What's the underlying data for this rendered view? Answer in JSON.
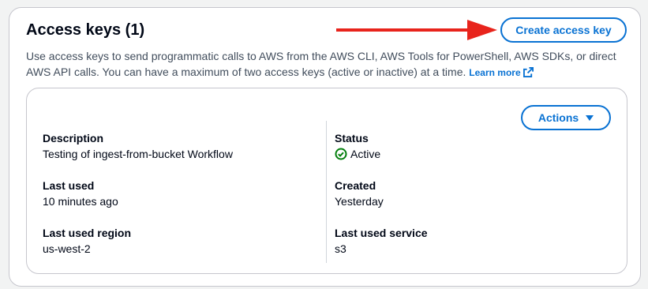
{
  "panel": {
    "title": "Access keys (1)",
    "description": "Use access keys to send programmatic calls to AWS from the AWS CLI, AWS Tools for PowerShell, AWS SDKs, or direct AWS API calls. You can have a maximum of two access keys (active or inactive) at a time.",
    "learn_more": "Learn more",
    "create_button": "Create access key"
  },
  "key_card": {
    "actions_button": "Actions",
    "left": {
      "description_label": "Description",
      "description_value": "Testing of ingest-from-bucket Workflow",
      "last_used_label": "Last used",
      "last_used_value": "10 minutes ago",
      "region_label": "Last used region",
      "region_value": "us-west-2"
    },
    "right": {
      "status_label": "Status",
      "status_value": "Active",
      "created_label": "Created",
      "created_value": "Yesterday",
      "service_label": "Last used service",
      "service_value": "s3"
    }
  },
  "colors": {
    "link": "#0972d3",
    "success": "#037f0c",
    "annotation_arrow": "#e8241c"
  },
  "icons": {
    "external_link": "external-link-icon",
    "status": "check-circle-icon",
    "dropdown": "caret-down-icon",
    "annotation": "red-arrow-annotation"
  }
}
